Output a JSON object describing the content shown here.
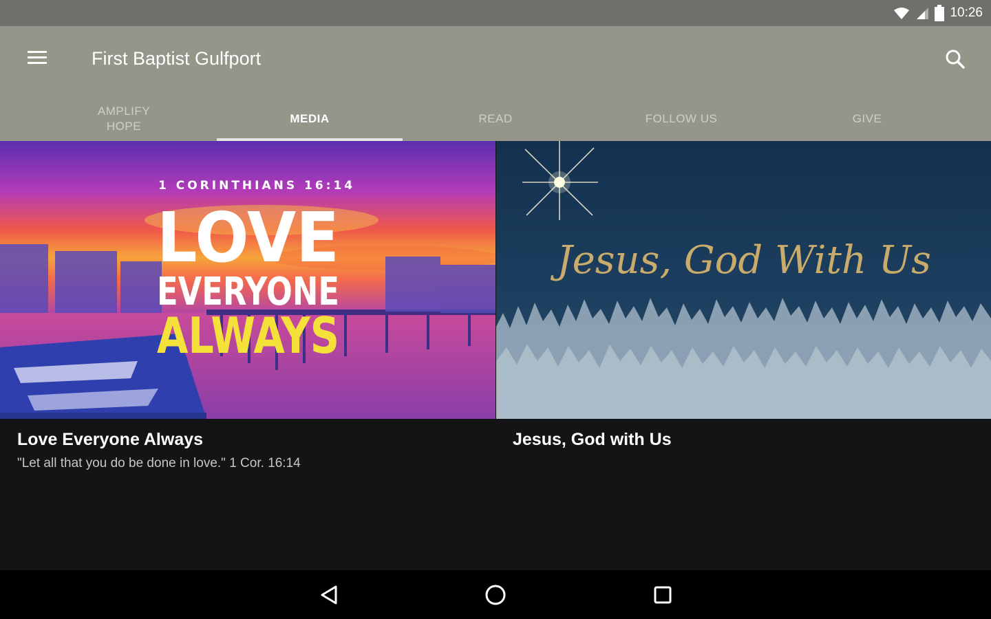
{
  "status_bar": {
    "time": "10:26",
    "icons": [
      "wifi-icon",
      "cell-signal-icon",
      "battery-icon"
    ]
  },
  "app_bar": {
    "title": "First Baptist Gulfport",
    "menu_icon": "hamburger-menu-icon",
    "search_icon": "search-icon",
    "background": "#95958a"
  },
  "tabs": [
    {
      "label": "AMPLIFY HOPE",
      "active": false
    },
    {
      "label": "MEDIA",
      "active": true
    },
    {
      "label": "READ",
      "active": false
    },
    {
      "label": "FOLLOW US",
      "active": false
    },
    {
      "label": "GIVE",
      "active": false
    }
  ],
  "media_cards": [
    {
      "title": "Love Everyone Always",
      "subtitle": "\"Let all that you do be done in love.\" 1 Cor. 16:14",
      "artwork": {
        "reference": "1 CORINTHIANS 16:14",
        "line1": "LOVE",
        "line2": "EVERYONE",
        "line3": "ALWAYS"
      }
    },
    {
      "title": "Jesus, God with Us",
      "subtitle": "",
      "artwork": {
        "script_text": "Jesus, God With Us"
      }
    }
  ],
  "nav_bar": {
    "icons": [
      "back-icon",
      "home-icon",
      "recents-icon"
    ]
  }
}
